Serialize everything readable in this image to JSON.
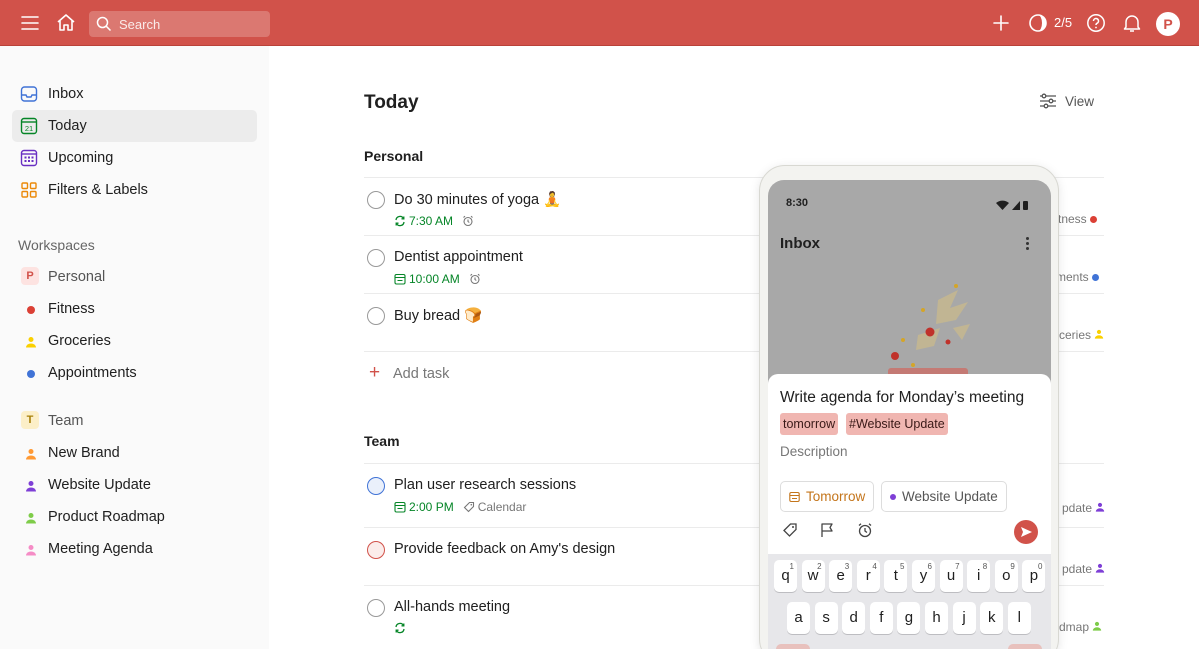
{
  "topbar": {
    "search_placeholder": "Search",
    "karma": "2/5",
    "avatar_letter": "P",
    "bg_color": "#d1524a"
  },
  "sidebar": {
    "nav": [
      {
        "label": "Inbox",
        "icon": "inbox-icon"
      },
      {
        "label": "Today",
        "icon": "calendar-today-icon",
        "active": true,
        "day": "21"
      },
      {
        "label": "Upcoming",
        "icon": "calendar-grid-icon"
      },
      {
        "label": "Filters & Labels",
        "icon": "filters-grid-icon"
      }
    ],
    "workspaces_heading": "Workspaces",
    "workspaces": [
      {
        "label": "Personal",
        "badge": "P",
        "projects": [
          {
            "label": "Fitness",
            "color": "#db4035"
          },
          {
            "label": "Groceries",
            "color": "#fad000"
          },
          {
            "label": "Appointments",
            "color": "#4073d6"
          }
        ]
      },
      {
        "label": "Team",
        "badge": "T",
        "projects": [
          {
            "label": "New Brand",
            "color": "#ff9933"
          },
          {
            "label": "Website Update",
            "color": "#7e3fd6"
          },
          {
            "label": "Product Roadmap",
            "color": "#7ecc49"
          },
          {
            "label": "Meeting Agenda",
            "color": "#f58cc6"
          }
        ]
      }
    ]
  },
  "main": {
    "title": "Today",
    "view_label": "View",
    "sections": [
      {
        "heading": "Personal",
        "tasks": [
          {
            "title": "Do 30 minutes of yoga 🧘",
            "time": "7:30 AM",
            "recurring": true,
            "reminder": true,
            "project_suffix": "tness",
            "project_color": "#db4035"
          },
          {
            "title": "Dentist appointment",
            "time": "10:00 AM",
            "recurring": false,
            "reminder": true,
            "project_suffix": "ments",
            "project_color": "#4073d6"
          },
          {
            "title": "Buy bread 🍞",
            "project_suffix": "ceries",
            "project_color": "#fad000"
          }
        ],
        "add_task": "Add task"
      },
      {
        "heading": "Team",
        "tasks": [
          {
            "title": "Plan user research sessions",
            "time": "2:00 PM",
            "label": "Calendar",
            "priority": "blue",
            "project_suffix": "pdate",
            "project_color": "#7e3fd6"
          },
          {
            "title": "Provide feedback on Amy's design",
            "priority": "red",
            "project_suffix": "pdate",
            "project_color": "#7e3fd6"
          },
          {
            "title": "All-hands meeting",
            "recurring": true,
            "project_suffix": "dmap",
            "project_color": "#7ecc49"
          }
        ]
      }
    ]
  },
  "phone": {
    "status_time": "8:30",
    "screen_title": "Inbox",
    "quick_add": {
      "task_text": "Write agenda for Monday’s meeting",
      "chips": [
        "tomorrow",
        "#Website Update"
      ],
      "description_placeholder": "Description",
      "date_pill": "Tomorrow",
      "project_pill": "Website Update"
    },
    "keyboard": {
      "row1": [
        "q",
        "w",
        "e",
        "r",
        "t",
        "y",
        "u",
        "i",
        "o",
        "p"
      ],
      "row1_nums": [
        "1",
        "2",
        "3",
        "4",
        "5",
        "6",
        "7",
        "8",
        "9",
        "0"
      ],
      "row2": [
        "a",
        "s",
        "d",
        "f",
        "g",
        "h",
        "j",
        "k",
        "l"
      ]
    }
  }
}
